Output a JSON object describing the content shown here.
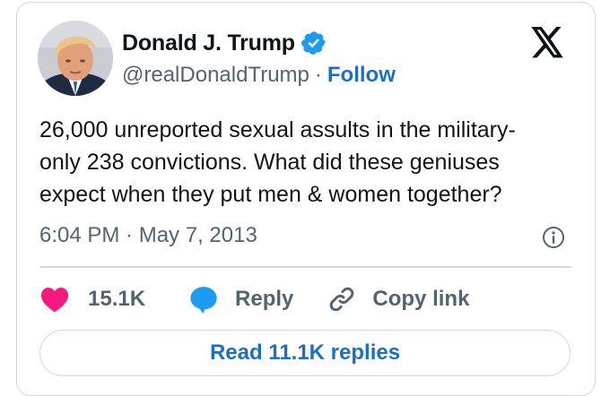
{
  "author": {
    "display_name": "Donald J. Trump",
    "handle": "@realDonaldTrump",
    "separator": "·",
    "follow_label": "Follow",
    "verified": true,
    "avatar_icon": "profile-photo"
  },
  "platform_icon": "x-logo-icon",
  "tweet": {
    "text": "26,000 unreported sexual assults in the military-\nonly 238 convictions. What did these geniuses\nexpect when they put men & women together?",
    "timestamp": "6:04 PM · May 7, 2013"
  },
  "actions": {
    "likes_count": "15.1K",
    "reply_label": "Reply",
    "copy_link_label": "Copy link"
  },
  "read_replies_label": "Read 11.1K replies",
  "colors": {
    "text_primary": "#0f1419",
    "text_secondary": "#536471",
    "link_blue": "#1d6fc4",
    "verified_blue": "#1d9bf0",
    "like_pink": "#f91880",
    "border": "#cfd9de"
  }
}
